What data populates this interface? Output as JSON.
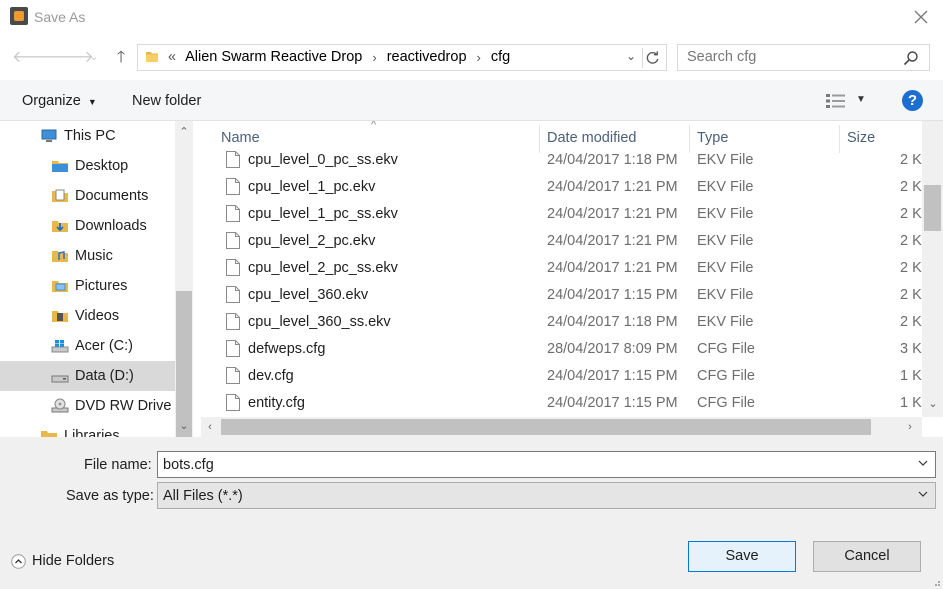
{
  "window": {
    "title": "Save As"
  },
  "address": {
    "overflow": "«",
    "crumbs": [
      "Alien Swarm Reactive Drop",
      "reactivedrop",
      "cfg"
    ]
  },
  "search": {
    "placeholder": "Search cfg"
  },
  "toolbar": {
    "organize_label": "Organize",
    "new_folder_label": "New folder",
    "help_label": "?"
  },
  "nav": {
    "items": [
      {
        "label": "This PC",
        "icon": "computer-icon",
        "indent": 1
      },
      {
        "label": "Desktop",
        "icon": "folder-icon",
        "indent": 2
      },
      {
        "label": "Documents",
        "icon": "documents-icon",
        "indent": 2
      },
      {
        "label": "Downloads",
        "icon": "downloads-icon",
        "indent": 2
      },
      {
        "label": "Music",
        "icon": "music-icon",
        "indent": 2
      },
      {
        "label": "Pictures",
        "icon": "pictures-icon",
        "indent": 2
      },
      {
        "label": "Videos",
        "icon": "videos-icon",
        "indent": 2
      },
      {
        "label": "Acer (C:)",
        "icon": "windows-drive-icon",
        "indent": 2
      },
      {
        "label": "Data (D:)",
        "icon": "drive-icon",
        "indent": 2,
        "selected": true
      },
      {
        "label": "DVD RW Drive",
        "icon": "dvd-drive-icon",
        "indent": 2
      },
      {
        "label": "Libraries",
        "icon": "libraries-icon",
        "indent": 1
      }
    ]
  },
  "columns": {
    "name": "Name",
    "date": "Date modified",
    "type": "Type",
    "size": "Size"
  },
  "files": [
    {
      "name": "cpu_level_0_pc_ss.ekv",
      "date": "24/04/2017 1:18 PM",
      "type": "EKV File",
      "size": "2 K"
    },
    {
      "name": "cpu_level_1_pc.ekv",
      "date": "24/04/2017 1:21 PM",
      "type": "EKV File",
      "size": "2 K"
    },
    {
      "name": "cpu_level_1_pc_ss.ekv",
      "date": "24/04/2017 1:21 PM",
      "type": "EKV File",
      "size": "2 K"
    },
    {
      "name": "cpu_level_2_pc.ekv",
      "date": "24/04/2017 1:21 PM",
      "type": "EKV File",
      "size": "2 K"
    },
    {
      "name": "cpu_level_2_pc_ss.ekv",
      "date": "24/04/2017 1:21 PM",
      "type": "EKV File",
      "size": "2 K"
    },
    {
      "name": "cpu_level_360.ekv",
      "date": "24/04/2017 1:15 PM",
      "type": "EKV File",
      "size": "2 K"
    },
    {
      "name": "cpu_level_360_ss.ekv",
      "date": "24/04/2017 1:18 PM",
      "type": "EKV File",
      "size": "2 K"
    },
    {
      "name": "defweps.cfg",
      "date": "28/04/2017 8:09 PM",
      "type": "CFG File",
      "size": "3 K"
    },
    {
      "name": "dev.cfg",
      "date": "24/04/2017 1:15 PM",
      "type": "CFG File",
      "size": "1 K"
    },
    {
      "name": "entity.cfg",
      "date": "24/04/2017 1:15 PM",
      "type": "CFG File",
      "size": "1 K"
    }
  ],
  "form": {
    "file_name_label": "File name:",
    "file_name_value": "bots.cfg",
    "save_type_label": "Save as type:",
    "save_type_value": "All Files (*.*)",
    "hide_folders_label": "Hide Folders",
    "save_label": "Save",
    "cancel_label": "Cancel"
  },
  "colors": {
    "accent": "#0078d7",
    "help": "#1c6ed0",
    "selected_nav": "#d9d9d9",
    "header_text": "#4c607a"
  }
}
